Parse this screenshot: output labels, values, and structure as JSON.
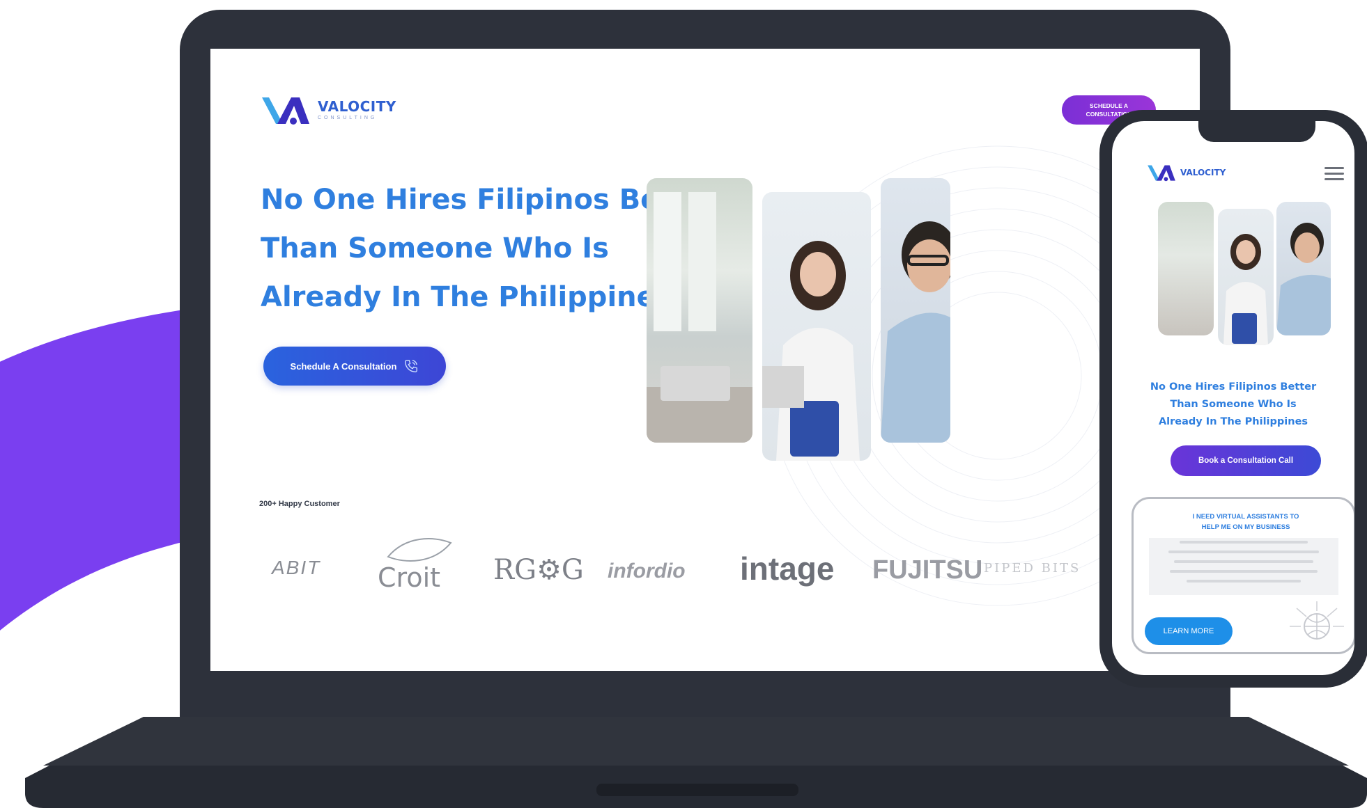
{
  "brand": {
    "name": "VALOCITY",
    "tagline": "CONSULTING",
    "accent": "#2f7fdf",
    "purple": "#7b2fd6"
  },
  "desktop": {
    "nav_cta": "SCHEDULE A CONSULTATION",
    "hero_line1": "No One Hires Filipinos Better",
    "hero_line2": "Than Someone Who Is",
    "hero_line3": "Already In The Philippines",
    "hero_button": "Schedule A Consultation",
    "happy_customers": "200+ Happy Customer",
    "clients": [
      "ABIT",
      "Croit",
      "RG⚙G",
      "infordio",
      "intage",
      "FUJITSU",
      "PIPED BITS"
    ]
  },
  "mobile": {
    "hero_line1": "No One Hires Filipinos Better",
    "hero_line2": "Than Someone Who Is",
    "hero_line3": "Already In The Philippines",
    "hero_button": "Book a Consultation Call",
    "card_title_line1": "I NEED VIRTUAL ASSISTANTS TO",
    "card_title_line2": "HELP ME ON MY BUSINESS",
    "card_button": "LEARN MORE"
  },
  "icons": [
    "logo-mark-icon",
    "phone-call-icon",
    "hamburger-menu-icon",
    "globe-network-icon"
  ]
}
